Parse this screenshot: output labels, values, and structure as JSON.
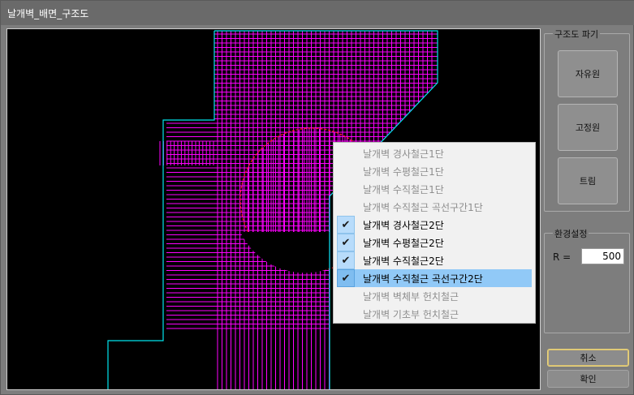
{
  "window": {
    "title": "날개벽_배면_구조도"
  },
  "panel": {
    "structure_group_title": "구조도 파기",
    "buttons": [
      {
        "label": "자유원"
      },
      {
        "label": "고정원"
      },
      {
        "label": "트림"
      }
    ],
    "env_group_title": "환경설정",
    "r_label": "R =",
    "r_value": "500",
    "cancel_label": "취소",
    "ok_label": "확인"
  },
  "context_menu": {
    "items": [
      {
        "label": "날개벽 경사철근1단",
        "checked": false,
        "enabled": false
      },
      {
        "label": "날개벽 수평철근1단",
        "checked": false,
        "enabled": false
      },
      {
        "label": "날개벽 수직철근1단",
        "checked": false,
        "enabled": false
      },
      {
        "label": "날개벽 수직철근 곡선구간1단",
        "checked": false,
        "enabled": false
      },
      {
        "label": "날개벽 경사철근2단",
        "checked": true,
        "enabled": true
      },
      {
        "label": "날개벽 수평철근2단",
        "checked": true,
        "enabled": true
      },
      {
        "label": "날개벽 수직철근2단",
        "checked": true,
        "enabled": true
      },
      {
        "label": "날개벽 수직철근 곡선구간2단",
        "checked": true,
        "enabled": true,
        "highlighted": true
      },
      {
        "label": "날개벽 벽체부 헌치철근",
        "checked": false,
        "enabled": false
      },
      {
        "label": "날개벽 기초부 헌치철근",
        "checked": false,
        "enabled": false
      }
    ]
  },
  "colors": {
    "outline": "#00e5ee",
    "rebar": "#ff00ff",
    "circle": "#ff1a1a",
    "menu_highlight": "#91c9f7"
  }
}
